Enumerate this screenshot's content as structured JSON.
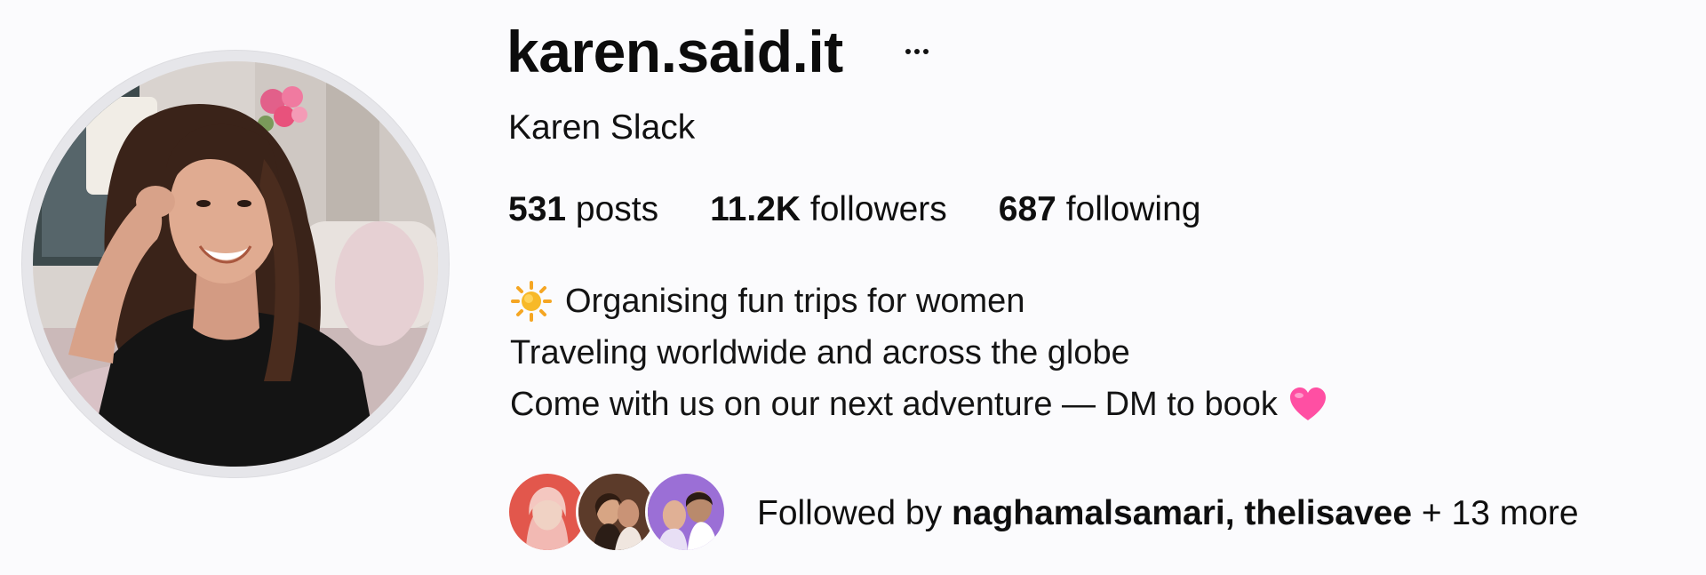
{
  "profile": {
    "username": "karen.said.it",
    "full_name": "Karen Slack",
    "avatar_icon": "profile-photo",
    "more_icon": "ellipsis-icon"
  },
  "stats": {
    "posts_count": "531",
    "posts_label": "posts",
    "followers_count": "11.2K",
    "followers_label": "followers",
    "following_count": "687",
    "following_label": "following"
  },
  "bio": {
    "line1_icon": "sun-emoji",
    "line1": "Organising fun trips for women",
    "line2": "Traveling worldwide and across the globe",
    "line3": "Come with us on our next adventure — DM to book",
    "line3_icon": "pink-heart-emoji"
  },
  "followed_by": {
    "prefix": "Followed by",
    "names": "naghamalsamari, thelisavee",
    "more": "+ 13 more",
    "avatars": [
      "follower-avatar-1",
      "follower-avatar-2",
      "follower-avatar-3"
    ]
  },
  "colors": {
    "background": "#fbfbfd",
    "ring": "#e6e6ea",
    "heart": "#ff4fa3",
    "sun": "#f7b928"
  }
}
